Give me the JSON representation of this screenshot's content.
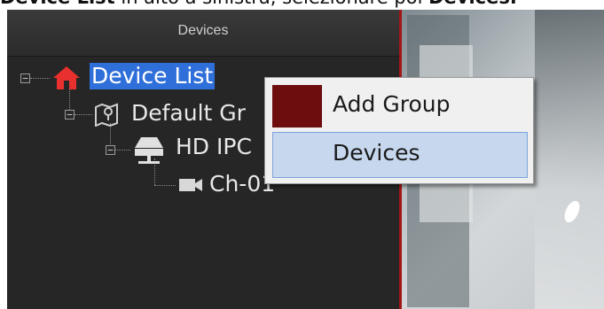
{
  "caption": {
    "part1": "Device List",
    "part2": " in alto a sinistra, selezionare poi ",
    "part3": "Devices."
  },
  "panel": {
    "title": "Devices"
  },
  "tree": {
    "root": "Device List",
    "group": "Default Gr",
    "device": "HD IPC",
    "channel": "Ch-01"
  },
  "context_menu": {
    "items": [
      {
        "label": "Add Group"
      },
      {
        "label": "Devices"
      }
    ]
  },
  "colors": {
    "selection": "#2f6fd9",
    "menu_hover": "#c7d7ee",
    "swatch": "#6e0d0d",
    "video_border": "#a31616"
  }
}
